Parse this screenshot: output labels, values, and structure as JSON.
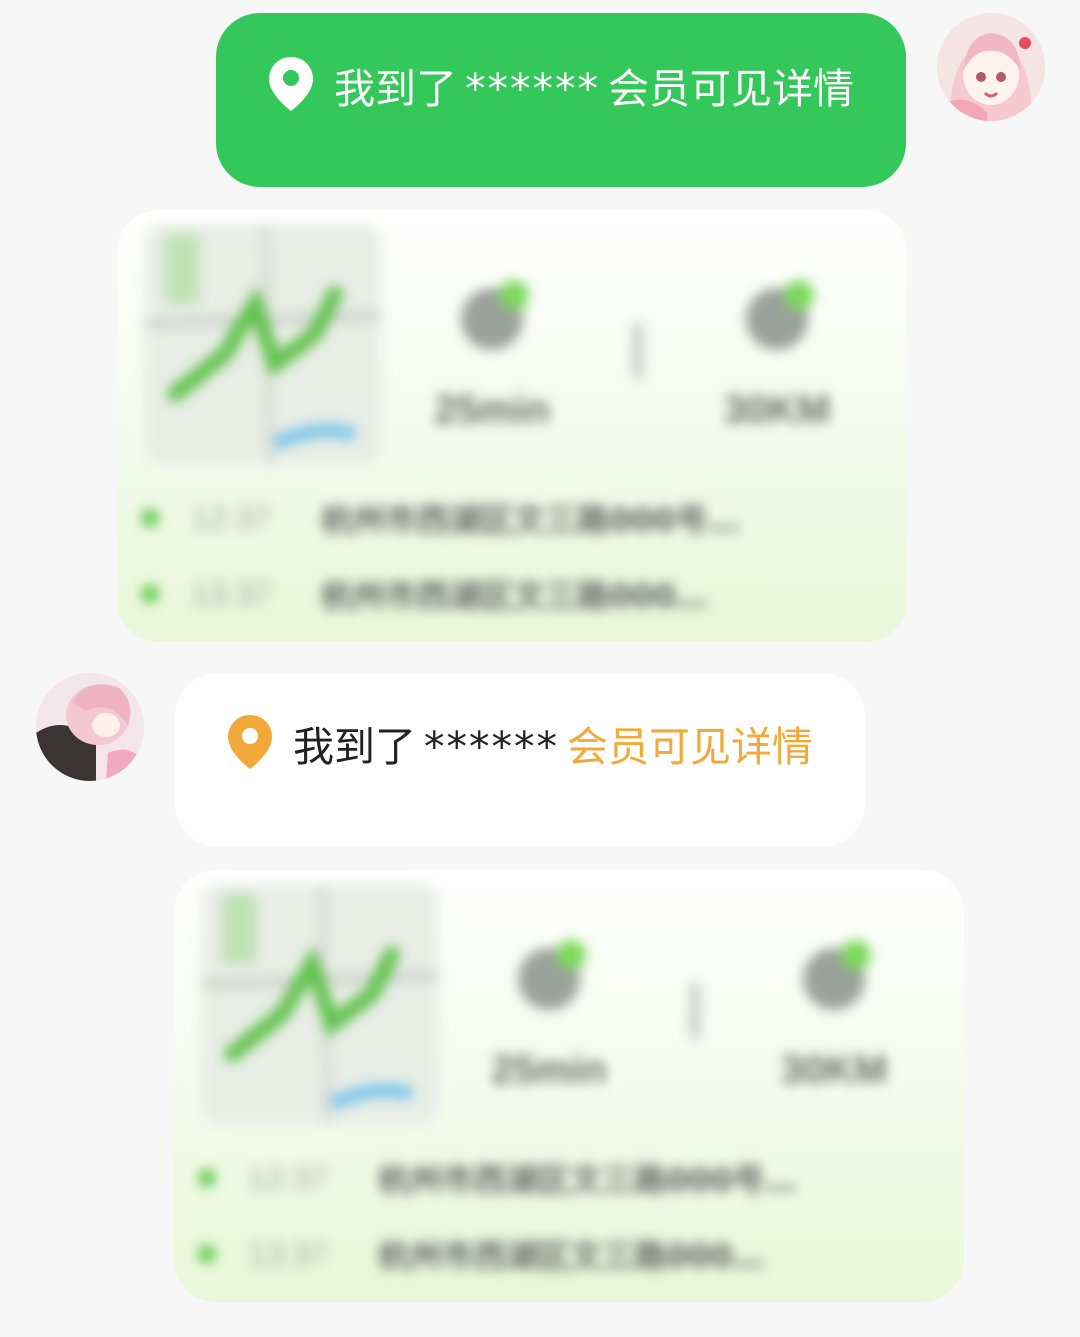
{
  "messages": [
    {
      "side": "sent",
      "prefix": "我到了",
      "masked": "******",
      "vip_text": "会员可见详情",
      "bubble_color": "#34c759",
      "icon": "location-pin-icon"
    },
    {
      "side": "received",
      "prefix": "我到了",
      "masked": "******",
      "vip_text": "会员可见详情",
      "bubble_color": "#ffffff",
      "vip_color": "#f3a93a",
      "icon": "location-pin-icon"
    }
  ],
  "route_cards": [
    {
      "duration": "25min",
      "distance": "30KM",
      "stops": [
        {
          "time": "12:37",
          "address": "杭州市西湖区文三路000号…"
        },
        {
          "time": "13:37",
          "address": "杭州市西湖区文三路000…"
        }
      ]
    },
    {
      "duration": "25min",
      "distance": "30KM",
      "stops": [
        {
          "time": "12:37",
          "address": "杭州市西湖区文三路000号…"
        },
        {
          "time": "13:37",
          "address": "杭州市西湖区文三路000…"
        }
      ]
    }
  ]
}
